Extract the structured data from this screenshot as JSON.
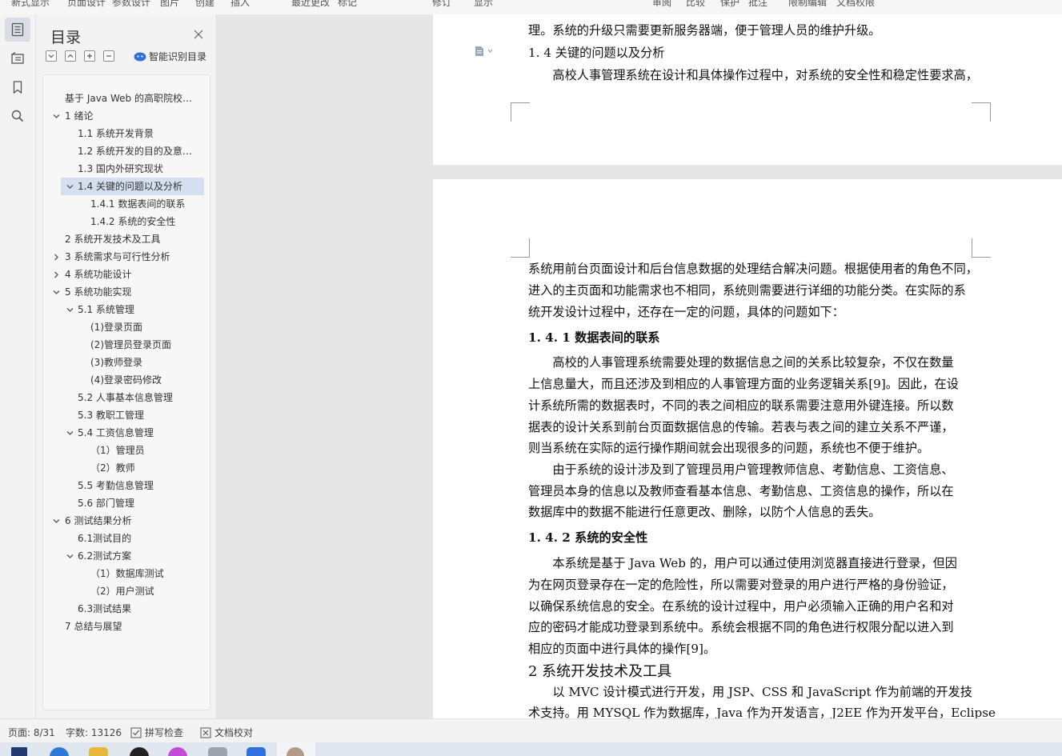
{
  "ribbon": {
    "items": [
      "新式显示",
      "页面设计",
      "参数设计",
      "图片",
      "创建",
      "插入",
      "最近更改",
      "标记",
      "修订",
      "显示",
      "审阅",
      "比较",
      "保护",
      "批注",
      "限制编辑",
      "文档权限"
    ]
  },
  "left_toolbar": {
    "icons": [
      "toc-icon",
      "navigation-icon",
      "bookmark-icon",
      "search-icon"
    ]
  },
  "toc": {
    "title": "目录",
    "smart_label": "智能识别目录",
    "items": [
      {
        "text": "基于 Java Web 的高职院校…",
        "level": 0,
        "arrow": "none"
      },
      {
        "text": "1  绪论",
        "level": 0,
        "arrow": "down"
      },
      {
        "text": "1.1 系统开发背景",
        "level": 1,
        "arrow": "none"
      },
      {
        "text": "1.2 系统开发的目的及意…",
        "level": 1,
        "arrow": "none"
      },
      {
        "text": "1.3 国内外研究现状",
        "level": 1,
        "arrow": "none"
      },
      {
        "text": "1.4 关键的问题以及分析",
        "level": 1,
        "arrow": "down",
        "selected": true
      },
      {
        "text": "1.4.1 数据表间的联系",
        "level": 2,
        "arrow": "none"
      },
      {
        "text": "1.4.2 系统的安全性",
        "level": 2,
        "arrow": "none"
      },
      {
        "text": "2  系统开发技术及工具",
        "level": 0,
        "arrow": "none"
      },
      {
        "text": "3  系统需求与可行性分析",
        "level": 0,
        "arrow": "right"
      },
      {
        "text": "4  系统功能设计",
        "level": 0,
        "arrow": "right"
      },
      {
        "text": "5  系统功能实现",
        "level": 0,
        "arrow": "down"
      },
      {
        "text": "5.1  系统管理",
        "level": 1,
        "arrow": "down"
      },
      {
        "text": "(1)登录页面",
        "level": 2,
        "arrow": "none"
      },
      {
        "text": "(2)管理员登录页面",
        "level": 2,
        "arrow": "none"
      },
      {
        "text": "(3)教师登录",
        "level": 2,
        "arrow": "none"
      },
      {
        "text": "(4)登录密码修改",
        "level": 2,
        "arrow": "none"
      },
      {
        "text": "5.2 人事基本信息管理",
        "level": 1,
        "arrow": "none"
      },
      {
        "text": "5.3 教职工管理",
        "level": 1,
        "arrow": "none"
      },
      {
        "text": "5.4 工资信息管理",
        "level": 1,
        "arrow": "down"
      },
      {
        "text": "（1）管理员",
        "level": 2,
        "arrow": "none"
      },
      {
        "text": "（2）教师",
        "level": 2,
        "arrow": "none"
      },
      {
        "text": "5.5 考勤信息管理",
        "level": 1,
        "arrow": "none"
      },
      {
        "text": "5.6 部门管理",
        "level": 1,
        "arrow": "none"
      },
      {
        "text": "6  测试结果分析",
        "level": 0,
        "arrow": "down"
      },
      {
        "text": "6.1测试目的",
        "level": 1,
        "arrow": "none"
      },
      {
        "text": "6.2测试方案",
        "level": 1,
        "arrow": "down"
      },
      {
        "text": "（1）数据库测试",
        "level": 2,
        "arrow": "none"
      },
      {
        "text": "（2）用户测试",
        "level": 2,
        "arrow": "none"
      },
      {
        "text": "6.3测试结果",
        "level": 1,
        "arrow": "none"
      },
      {
        "text": "7  总结与展望",
        "level": 0,
        "arrow": "none"
      }
    ]
  },
  "doc": {
    "page1_lines": [
      {
        "text": "理。系统的升级只需要更新服务器端，便于管理人员的维护升级。",
        "cls": ""
      },
      {
        "text": "1. 4 关键的问题以及分析",
        "cls": ""
      },
      {
        "text": "　　高校人事管理系统在设计和具体操作过程中，对系统的安全性和稳定性要求高，",
        "cls": ""
      }
    ],
    "page2_lines": [
      {
        "text": "系统用前台页面设计和后台信息数据的处理结合解决问题。根据使用者的角色不同，",
        "cls": ""
      },
      {
        "text": "进入的主页面和功能需求也不相同，系统则需要进行详细的功能分类。在实际的系",
        "cls": ""
      },
      {
        "text": "统开发设计过程中，还存在一定的问题，具体的问题如下：",
        "cls": ""
      },
      {
        "text": "1. 4. 1 数据表间的联系",
        "cls": "head3"
      },
      {
        "text": "　　高校的人事管理系统需要处理的数据信息之间的关系比较复杂，不仅在数量",
        "cls": ""
      },
      {
        "text": "上信息量大，而且还涉及到相应的人事管理方面的业务逻辑关系[9]。因此，在设",
        "cls": ""
      },
      {
        "text": "计系统所需的数据表时，不同的表之间相应的联系需要注意用外键连接。所以数",
        "cls": ""
      },
      {
        "text": "据表的设计关系到前台页面数据信息的传输。若表与表之间的建立关系不严谨，",
        "cls": ""
      },
      {
        "text": "则当系统在实际的运行操作期间就会出现很多的问题，系统也不便于维护。",
        "cls": ""
      },
      {
        "text": "　　由于系统的设计涉及到了管理员用户管理教师信息、考勤信息、工资信息、",
        "cls": ""
      },
      {
        "text": "管理员本身的信息以及教师查看基本信息、考勤信息、工资信息的操作，所以在",
        "cls": ""
      },
      {
        "text": "数据库中的数据不能进行任意更改、删除，以防个人信息的丢失。",
        "cls": ""
      },
      {
        "text": "1. 4. 2 系统的安全性",
        "cls": "head3"
      },
      {
        "text": "　　本系统是基于 Java Web 的，用户可以通过使用浏览器直接进行登录，但因",
        "cls": ""
      },
      {
        "text": "为在网页登录存在一定的危险性，所以需要对登录的用户进行严格的身份验证，",
        "cls": ""
      },
      {
        "text": "以确保系统信息的安全。在系统的设计过程中，用户必须输入正确的用户名和对",
        "cls": ""
      },
      {
        "text": "应的密码才能成功登录到系统中。系统会根据不同的角色进行权限分配以进入到",
        "cls": ""
      },
      {
        "text": "相应的页面中进行具体的操作[9]。",
        "cls": ""
      },
      {
        "text": "2  系统开发技术及工具",
        "cls": "head1"
      },
      {
        "text": "　　以 MVC 设计模式进行开发，用 JSP、CSS 和 JavaScript 作为前端的开发技",
        "cls": ""
      },
      {
        "text": "术支持。用 MYSQL 作为数据库，Java 作为开发语言，J2EE 作为开发平台，Eclipse",
        "cls": ""
      }
    ]
  },
  "status": {
    "page": "页面: 8/31",
    "words": "字数: 13126",
    "spell": "拼写检查",
    "proof": "文档校对"
  },
  "colors": {
    "selected_row": "#d6dff0",
    "accent_blue": "#2f6fde"
  }
}
